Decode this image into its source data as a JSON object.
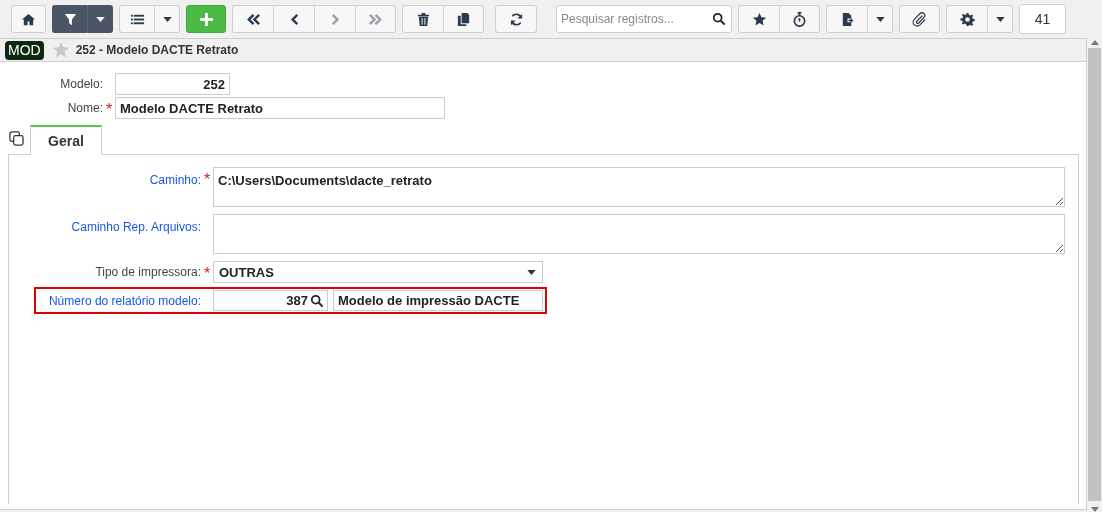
{
  "toolbar": {
    "filter_active": true,
    "navigation": [
      {
        "disabled": false
      },
      {
        "disabled": false
      },
      {
        "disabled": true
      },
      {
        "disabled": true
      }
    ],
    "search": {
      "placeholder": "Pesquisar registros..."
    },
    "record_count": "41"
  },
  "header": {
    "badge": "MOD",
    "favorite": false,
    "title": "252 - Modelo DACTE Retrato"
  },
  "record": {
    "fields": [
      {
        "label": "Modelo:",
        "value": "252"
      },
      {
        "label": "Nome:",
        "required_mark": "*",
        "value": "Modelo DACTE Retrato"
      }
    ]
  },
  "tabs": [
    {
      "label": "Geral",
      "selected": true
    }
  ],
  "form": [
    {
      "kind": "textarea",
      "label": "Caminho:",
      "required_mark": "*",
      "link": true,
      "value": "C:\\Users\\Documents\\dacte_retrato",
      "highlighted": false
    },
    {
      "kind": "textarea",
      "label": "Caminho Rep. Arquivos:",
      "link": true,
      "highlighted": false
    },
    {
      "kind": "select",
      "label": "Tipo de impressora:",
      "required_mark": "*",
      "link": false,
      "value": "OUTRAS",
      "highlighted": false
    },
    {
      "kind": "lookup",
      "label": "Número do relatório modelo:",
      "link": true,
      "value": "387",
      "description": "Modelo de impressão DACTE",
      "highlighted": true
    }
  ]
}
